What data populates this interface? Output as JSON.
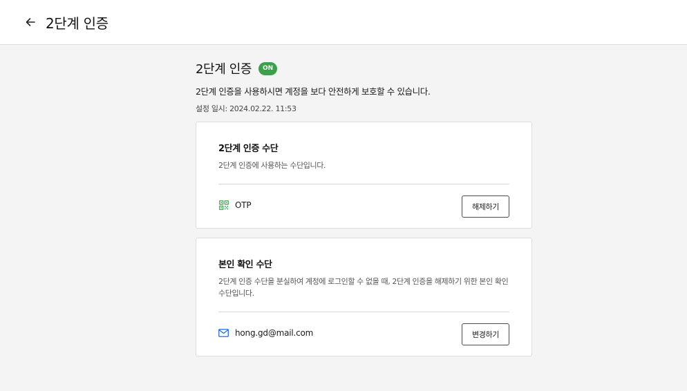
{
  "header": {
    "title": "2단계 인증"
  },
  "section": {
    "title": "2단계 인증",
    "status_badge": "ON",
    "description": "2단계 인증을 사용하시면 계정을 보다 안전하게 보호할 수 있습니다.",
    "setup_date": "설정 일시: 2024.02.22. 11:53"
  },
  "otp_card": {
    "title": "2단계 인증 수단",
    "description": "2단계 인증에 사용하는 수단입니다.",
    "method_icon": "qr-code-icon",
    "method_label": "OTP",
    "button_label": "해제하기"
  },
  "identity_card": {
    "title": "본인 확인 수단",
    "description": "2단계 인증 수단을 분실하여 계정에 로그인할 수 없을 때, 2단계 인증을 해제하기 위한 본인 확인 수단입니다.",
    "method_icon": "mail-icon",
    "method_label": "hong.gd@mail.com",
    "button_label": "변경하기"
  },
  "colors": {
    "badge_green": "#3aa14a",
    "icon_green": "#3aa14a",
    "icon_blue": "#1f6fe0",
    "background": "#f4f4f4"
  }
}
